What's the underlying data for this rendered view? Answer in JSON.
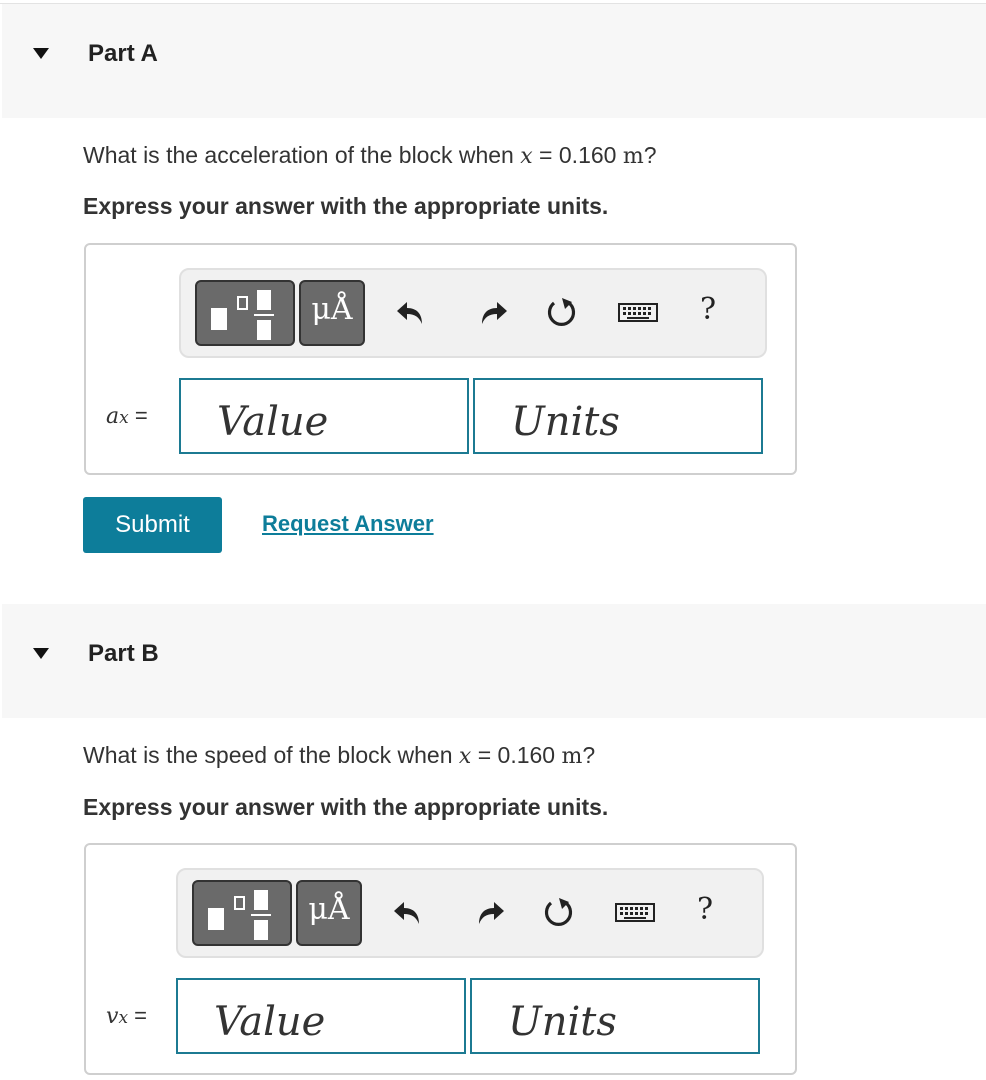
{
  "parts": [
    {
      "title": "Part A",
      "question_prefix": "What is the acceleration of the block when",
      "question_var": "x",
      "question_eq": " = 0.160 ",
      "question_unit": "m",
      "question_suffix": "?",
      "instruction": "Express your answer with the appropriate units.",
      "var_symbol": "a",
      "var_subscript": "x",
      "var_eq": " =",
      "value_placeholder": "Value",
      "units_placeholder": "Units",
      "submit_label": "Submit",
      "request_label": "Request Answer"
    },
    {
      "title": "Part B",
      "question_prefix": "What is the speed of the block when",
      "question_var": "x",
      "question_eq": " = 0.160 ",
      "question_unit": "m",
      "question_suffix": "?",
      "instruction": "Express your answer with the appropriate units.",
      "var_symbol": "v",
      "var_subscript": "x",
      "var_eq": " =",
      "value_placeholder": "Value",
      "units_placeholder": "Units"
    }
  ],
  "toolbar": {
    "units_glyph": "μÅ",
    "help_glyph": "?",
    "icons": [
      "templates-icon",
      "units-icon",
      "undo-icon",
      "redo-icon",
      "reset-icon",
      "keyboard-icon",
      "help-icon"
    ]
  },
  "colors": {
    "accent": "#0d7d9a",
    "field_border": "#1c7a92",
    "header_bg": "#f7f7f7"
  }
}
